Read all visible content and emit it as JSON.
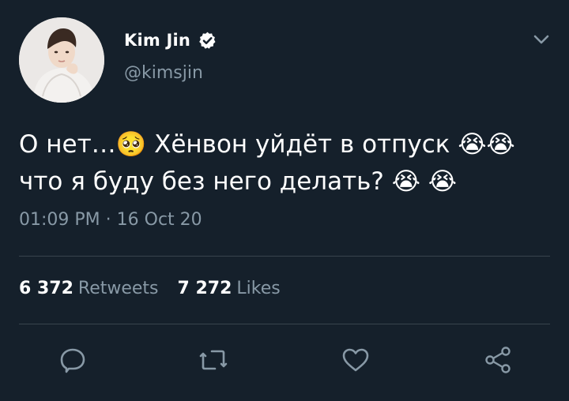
{
  "user": {
    "display_name": "Kim Jin",
    "handle": "@kimsjin",
    "verified_icon": "verified-badge-icon"
  },
  "tweet": {
    "line1": "О нет…🥺 Хёнвон уйдёт в отпуск 😭😭",
    "line2": "что я буду без него делать? 😭 😭",
    "time": "01:09 PM",
    "separator": "·",
    "date": "16 Oct 20"
  },
  "stats": {
    "retweets_count": "6 372",
    "retweets_label": "Retweets",
    "likes_count": "7 272",
    "likes_label": "Likes"
  },
  "actions": [
    "reply-icon",
    "retweet-icon",
    "like-icon",
    "share-icon"
  ],
  "colors": {
    "background": "#15202b",
    "text": "#ffffff",
    "secondary_text": "#8899a6",
    "divider": "#38444d"
  }
}
